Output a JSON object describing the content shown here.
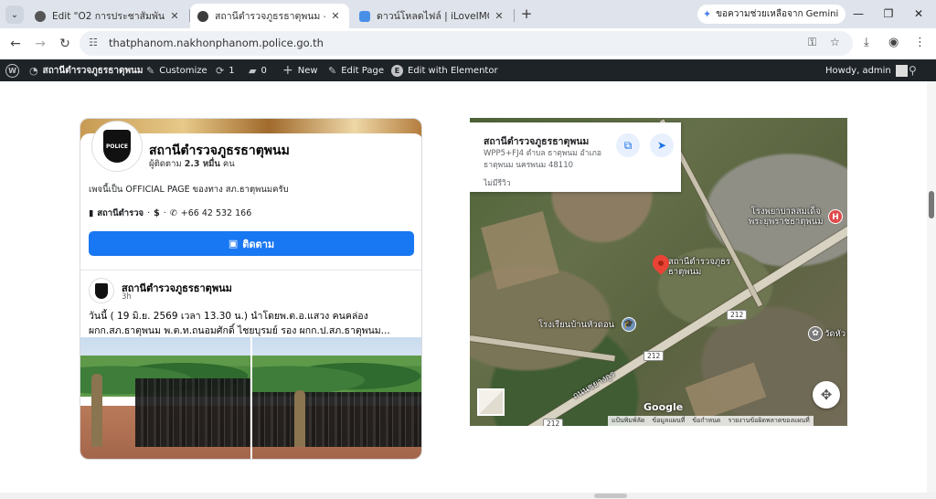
{
  "browser": {
    "tabs": [
      {
        "title": "Edit \"O2 การประชาสัมพันธ์ข้อมูลข่าว",
        "favicon_color": "#555555",
        "active": false
      },
      {
        "title": "สถานีตำรวจภูธรธาตุพนม – สำนักงาน",
        "favicon_color": "#3c3c3c",
        "active": true
      },
      {
        "title": "ดาวน์โหลดไฟล์ | iLoveIMG",
        "favicon_color": "#4a8fe7",
        "active": false
      }
    ],
    "gemini_label": "ขอความช่วยเหลือจาก Gemini",
    "url": "thatphanom.nakhonphanom.police.go.th"
  },
  "adminbar": {
    "site_name": "สถานีตำรวจภูธรธาตุพนม",
    "customize": "Customize",
    "updates_count": "1",
    "comments_count": "0",
    "new_label": "New",
    "edit_page": "Edit Page",
    "edit_elementor": "Edit with Elementor",
    "howdy": "Howdy, admin"
  },
  "facebook": {
    "page_name": "สถานีตำรวจภูธรธาตุพนม",
    "followers_prefix": "ผู้ติดตาม ",
    "followers_count": "2.3 หมื่น",
    "followers_suffix": " คน",
    "badge_text": "POLICE",
    "description": "เพจนี้เป็น OFFICIAL PAGE ของทาง สภ.ธาตุพนมครับ",
    "category": "สถานีตำรวจ",
    "price": "$",
    "phone": "+66 42 532 166",
    "follow_label": "ติดตาม",
    "post": {
      "author": "สถานีตำรวจภูธรธาตุพนม",
      "time": "3h",
      "text_line1": "วันนี้ ( 19 มิ.ย. 2569 เวลา 13.30 น.) นำโดยพ.ต.อ.แสวง คนคล่อง",
      "text_line2": "ผกก.สภ.ธาตุพนม พ.ต.ท.ถนอมศักดิ์ ไชยบุรมย์ รอง ผกก.ป.สภ.ธาตุพนม..."
    }
  },
  "map": {
    "place_name": "สถานีตำรวจภูธรธาตุพนม",
    "address": "WPP5+FJ4 ตำบล ธาตุพนม อำเภอ ธาตุพนม นครพนม 48110",
    "reviews": "ไม่มีรีวิว",
    "labels": {
      "hospital": "โรงพยาบาลสมเด็จ\nพระยุพราชธาตุพนม",
      "police": "สถานีตำรวจภูธร\nธาตุพนม",
      "school": "โรงเรียนบ้านหัวดอน",
      "temple": "วัดหัว",
      "road": "ถนนชยางกูร",
      "route_212": "212",
      "route_212b": "212",
      "route_212c": "212"
    },
    "google": "Google",
    "attribution": [
      "แป้นพิมพ์ลัด",
      "ข้อมูลแผนที่",
      "ข้อกำหนด",
      "รายงานข้อผิดพลาดของแผนที่"
    ]
  }
}
